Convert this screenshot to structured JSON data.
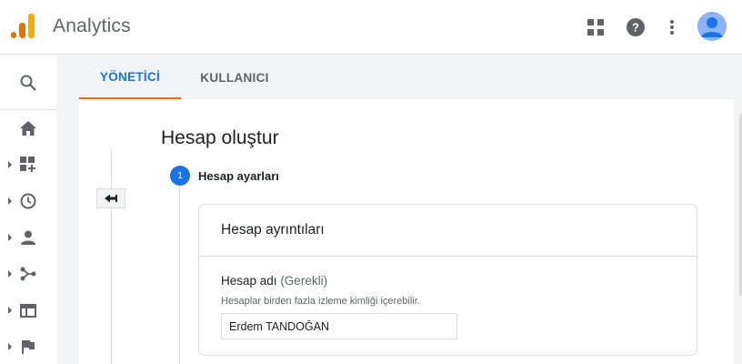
{
  "header": {
    "app_title": "Analytics",
    "icons": [
      "analytics-logo",
      "apps-grid-icon",
      "help-icon",
      "more-vert-icon",
      "account-avatar"
    ]
  },
  "sidebar": {
    "items": [
      {
        "icon": "search-icon",
        "expandable": false
      },
      {
        "icon": "home-icon",
        "expandable": false
      },
      {
        "icon": "dashboard-add-icon",
        "expandable": true
      },
      {
        "icon": "clock-icon",
        "expandable": true
      },
      {
        "icon": "person-icon",
        "expandable": true
      },
      {
        "icon": "fork-icon",
        "expandable": true
      },
      {
        "icon": "web-icon",
        "expandable": true
      },
      {
        "icon": "flag-icon",
        "expandable": true
      }
    ]
  },
  "tabs": [
    {
      "label": "YÖNETİCİ",
      "active": true
    },
    {
      "label": "KULLANICI",
      "active": false
    }
  ],
  "page": {
    "title": "Hesap oluştur",
    "step_number": "1",
    "step_label": "Hesap ayarları"
  },
  "card": {
    "title": "Hesap ayrıntıları",
    "field_label": "Hesap adı",
    "field_required": "(Gerekli)",
    "field_help": "Hesaplar birden fazla izleme kimliği içerebilir.",
    "field_value": "Erdem TANDOĞAN"
  },
  "colors": {
    "accent": "#1a73e8",
    "active_tab_underline": "#e8710a",
    "logo_orange": "#f9ab00",
    "logo_dark_orange": "#e37400"
  }
}
